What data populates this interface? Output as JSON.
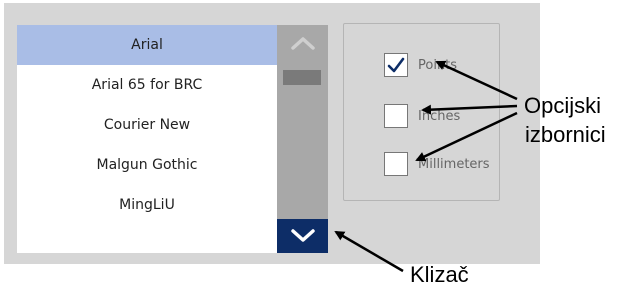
{
  "font_list": {
    "items": [
      {
        "label": "Arial",
        "selected": true
      },
      {
        "label": "Arial 65 for BRC",
        "selected": false
      },
      {
        "label": "Courier New",
        "selected": false
      },
      {
        "label": "Malgun Gothic",
        "selected": false
      },
      {
        "label": "MingLiU",
        "selected": false
      }
    ]
  },
  "scrollbar": {
    "up_icon": "chevron-up-icon",
    "down_icon": "chevron-down-icon"
  },
  "units": {
    "options": [
      {
        "label": "Points",
        "checked": true
      },
      {
        "label": "Inches",
        "checked": false
      },
      {
        "label": "Millimeters",
        "checked": false
      }
    ]
  },
  "callouts": {
    "options_label_line1": "Opcijski",
    "options_label_line2": "izbornici",
    "slider_label": "Klizač"
  },
  "colors": {
    "selected_row": "#a9bde6",
    "scroll_down_button": "#0d2d67",
    "panel_background": "#d6d6d6"
  }
}
